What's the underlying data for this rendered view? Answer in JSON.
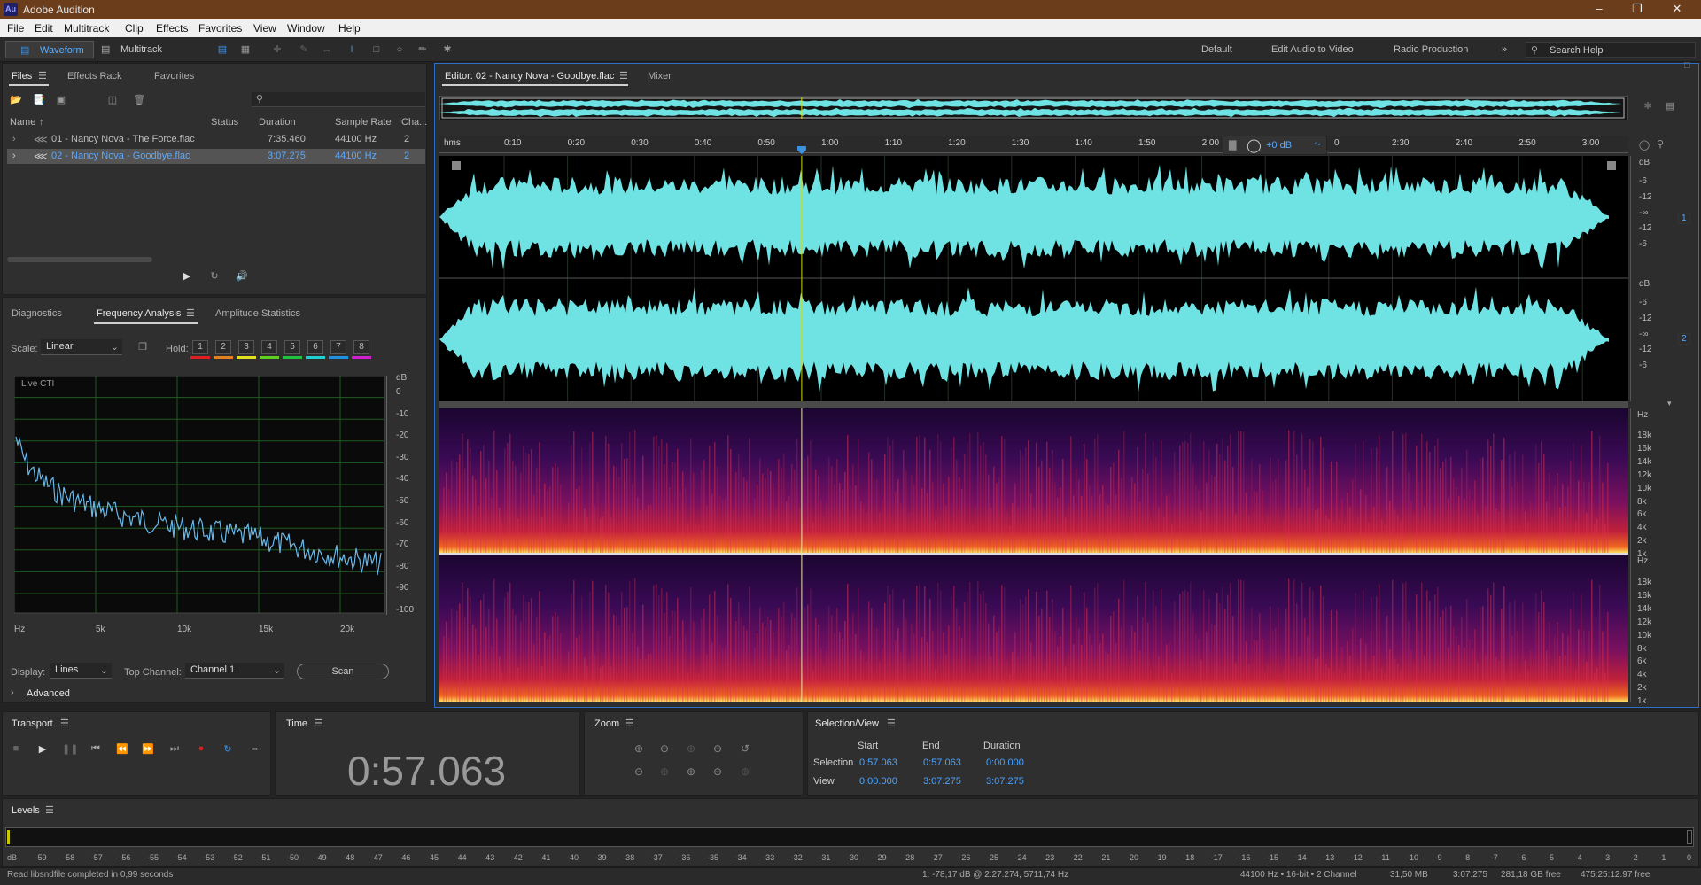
{
  "window": {
    "title": "Adobe Audition",
    "logo": "Au"
  },
  "menu": [
    "File",
    "Edit",
    "Multitrack",
    "Clip",
    "Effects",
    "Favorites",
    "View",
    "Window",
    "Help"
  ],
  "toolbar": {
    "waveform": "Waveform",
    "multitrack": "Multitrack",
    "workspaces": [
      "Default",
      "Edit Audio to Video",
      "Radio Production"
    ],
    "search_placeholder": "Search Help"
  },
  "files": {
    "tabs": [
      "Files",
      "Effects Rack",
      "Favorites"
    ],
    "columns": [
      "Name",
      "Status",
      "Duration",
      "Sample Rate",
      "Cha..."
    ],
    "rows": [
      {
        "name": "01 - Nancy Nova - The Force.flac",
        "status": "",
        "duration": "7:35.460",
        "rate": "44100 Hz",
        "ch": "2"
      },
      {
        "name": "02 - Nancy Nova - Goodbye.flac",
        "status": "",
        "duration": "3:07.275",
        "rate": "44100 Hz",
        "ch": "2"
      }
    ]
  },
  "analysis": {
    "tabs": [
      "Diagnostics",
      "Frequency Analysis",
      "Amplitude Statistics"
    ],
    "scale_label": "Scale:",
    "scale_value": "Linear",
    "hold_label": "Hold:",
    "hold": [
      "1",
      "2",
      "3",
      "4",
      "5",
      "6",
      "7",
      "8"
    ],
    "hold_colors": [
      "#e02020",
      "#e08020",
      "#e0e020",
      "#60d020",
      "#20c040",
      "#20d0d0",
      "#2090e0",
      "#d020d0"
    ],
    "live_cti": "Live CTI",
    "y_unit": "dB",
    "y_ticks": [
      "0",
      "-10",
      "-20",
      "-30",
      "-40",
      "-50",
      "-60",
      "-70",
      "-80",
      "-90",
      "-100"
    ],
    "x_ticks": [
      "Hz",
      "5k",
      "10k",
      "15k",
      "20k"
    ],
    "display_label": "Display:",
    "display_value": "Lines",
    "top_channel_label": "Top Channel:",
    "top_channel_value": "Channel 1",
    "scan": "Scan",
    "advanced": "Advanced"
  },
  "editor": {
    "tab": "Editor: 02 - Nancy Nova - Goodbye.flac",
    "mixer": "Mixer",
    "ruler": [
      "hms",
      "0:10",
      "0:20",
      "0:30",
      "0:40",
      "0:50",
      "1:00",
      "1:10",
      "1:20",
      "1:30",
      "1:40",
      "1:50",
      "2:00",
      "0",
      "2:30",
      "2:40",
      "2:50",
      "3:00"
    ],
    "gain": "+0 dB",
    "db_labels": [
      "dB",
      "-6",
      "-12",
      "-∞",
      "-12",
      "-6"
    ],
    "ch1": "1",
    "ch2": "2",
    "hz_labels": [
      "Hz",
      "18k",
      "16k",
      "14k",
      "12k",
      "10k",
      "8k",
      "6k",
      "4k",
      "2k",
      "1k"
    ],
    "playhead_fraction": 0.3047
  },
  "transport": {
    "title": "Transport"
  },
  "time": {
    "title": "Time",
    "value": "0:57.063"
  },
  "zoom": {
    "title": "Zoom"
  },
  "selection": {
    "title": "Selection/View",
    "cols": [
      "Start",
      "End",
      "Duration"
    ],
    "sel_label": "Selection",
    "view_label": "View",
    "sel": [
      "0:57.063",
      "0:57.063",
      "0:00.000"
    ],
    "view": [
      "0:00.000",
      "3:07.275",
      "3:07.275"
    ]
  },
  "levels": {
    "title": "Levels",
    "ticks": [
      "dB",
      "-59",
      "-58",
      "-57",
      "-56",
      "-55",
      "-54",
      "-53",
      "-52",
      "-51",
      "-50",
      "-49",
      "-48",
      "-47",
      "-46",
      "-45",
      "-44",
      "-43",
      "-42",
      "-41",
      "-40",
      "-39",
      "-38",
      "-37",
      "-36",
      "-35",
      "-34",
      "-33",
      "-32",
      "-31",
      "-30",
      "-29",
      "-28",
      "-27",
      "-26",
      "-25",
      "-24",
      "-23",
      "-22",
      "-21",
      "-20",
      "-19",
      "-18",
      "-17",
      "-16",
      "-15",
      "-14",
      "-13",
      "-12",
      "-11",
      "-10",
      "-9",
      "-8",
      "-7",
      "-6",
      "-5",
      "-4",
      "-3",
      "-2",
      "-1",
      "0"
    ]
  },
  "status": {
    "left": "Read libsndfile completed in 0,99 seconds",
    "cursor": "1: -78,17 dB @ 2:27.274, 5711,74 Hz",
    "format": "44100 Hz • 16-bit • 2 Channel",
    "size": "31,50 MB",
    "dur": "3:07.275",
    "free": "281,18 GB free",
    "free_time": "475:25:12.97 free"
  }
}
